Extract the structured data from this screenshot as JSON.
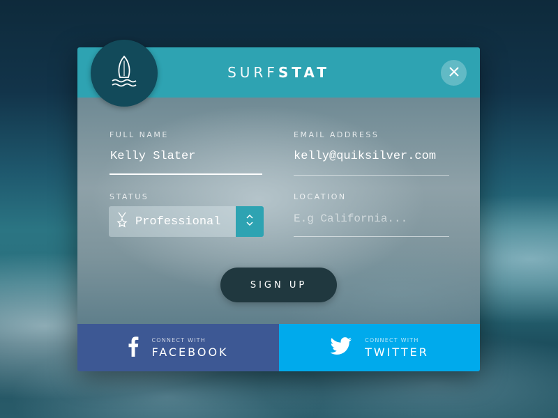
{
  "brand": {
    "light": "SURF",
    "bold": "STAT"
  },
  "icons": {
    "logo": "surfboard-waves-icon",
    "close": "close-icon",
    "status": "medal-star-icon",
    "select_arrow": "chevron-up-down-icon",
    "facebook": "facebook-icon",
    "twitter": "twitter-bird-icon"
  },
  "form": {
    "full_name": {
      "label": "FULL NAME",
      "value": "Kelly Slater"
    },
    "email": {
      "label": "EMAIL ADDRESS",
      "value": "kelly@quiksilver.com"
    },
    "status": {
      "label": "STATUS",
      "value": "Professional"
    },
    "location": {
      "label": "LOCATION",
      "placeholder": "E.g California..."
    }
  },
  "signup_label": "SIGN UP",
  "social": {
    "facebook": {
      "small": "CONNECT WITH",
      "big": "FACEBOOK"
    },
    "twitter": {
      "small": "CONNECT WITH",
      "big": "TWITTER"
    }
  },
  "colors": {
    "header": "#2ea3b2",
    "logo_circle": "#124a5a",
    "signup": "#20383f",
    "facebook": "#3d5894",
    "twitter": "#00aaec"
  }
}
